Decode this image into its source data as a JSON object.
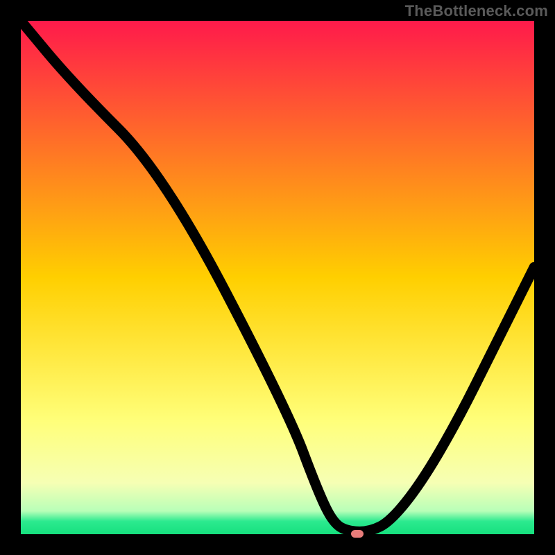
{
  "watermark": "TheBottleneck.com",
  "marker": {
    "color": "#e77c7a"
  },
  "chart_data": {
    "type": "line",
    "title": "",
    "xlabel": "",
    "ylabel": "",
    "grid": false,
    "legend": false,
    "background_gradient": [
      {
        "pos": 0.0,
        "color": "#ff1a4b"
      },
      {
        "pos": 0.5,
        "color": "#ffcf00"
      },
      {
        "pos": 0.78,
        "color": "#ffff7a"
      },
      {
        "pos": 0.9,
        "color": "#f6ffb4"
      },
      {
        "pos": 0.955,
        "color": "#b8ffb8"
      },
      {
        "pos": 0.975,
        "color": "#2cea8f"
      },
      {
        "pos": 1.0,
        "color": "#16e07e"
      }
    ],
    "x_range": [
      0,
      100
    ],
    "y_range": [
      0,
      100
    ],
    "series": [
      {
        "name": "curve",
        "x": [
          0,
          10,
          28,
          52,
          58,
          61,
          64,
          68,
          72,
          78,
          85,
          92,
          100
        ],
        "y": [
          100,
          88,
          70,
          24,
          8,
          2,
          0.5,
          0.5,
          2.5,
          10,
          22,
          36,
          52
        ]
      }
    ],
    "marker": {
      "x": 65.5,
      "y": 0.2
    }
  }
}
